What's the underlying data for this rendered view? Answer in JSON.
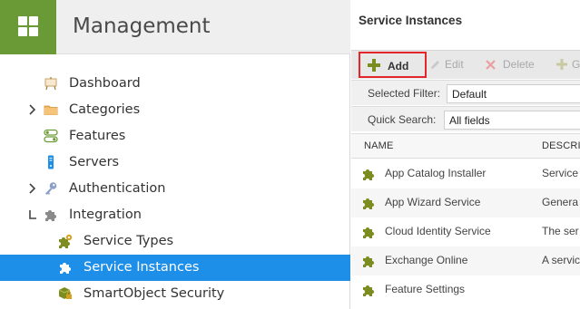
{
  "management": {
    "title": "Management"
  },
  "nav": {
    "items": [
      {
        "label": "Dashboard",
        "icon": "easel-icon"
      },
      {
        "label": "Categories",
        "icon": "folder-icon",
        "expandable": true
      },
      {
        "label": "Features",
        "icon": "toggle-icon"
      },
      {
        "label": "Servers",
        "icon": "server-icon"
      },
      {
        "label": "Authentication",
        "icon": "key-icon",
        "expandable": true
      },
      {
        "label": "Integration",
        "icon": "puzzle-icon",
        "expanded": true
      },
      {
        "label": "Service Types",
        "icon": "puzzle-gear-icon"
      },
      {
        "label": "Service Instances",
        "icon": "puzzle-icon",
        "selected": true
      },
      {
        "label": "SmartObject Security",
        "icon": "smartobject-lock-icon"
      }
    ]
  },
  "page": {
    "title": "Service Instances"
  },
  "toolbar": {
    "add_label": "Add",
    "edit_label": "Edit",
    "delete_label": "Delete",
    "partial_label": "G"
  },
  "filters": {
    "selected_filter_label": "Selected Filter:",
    "selected_filter_value": "Default",
    "quick_search_label": "Quick Search:",
    "quick_search_value": "All fields"
  },
  "table": {
    "columns": [
      "NAME",
      "DESCRI"
    ],
    "rows": [
      {
        "name": "App Catalog Installer",
        "desc": "Service"
      },
      {
        "name": "App Wizard Service",
        "desc": "Genera"
      },
      {
        "name": "Cloud Identity Service",
        "desc": "The ser"
      },
      {
        "name": "Exchange Online",
        "desc": "A servic"
      },
      {
        "name": "Feature Settings",
        "desc": ""
      }
    ]
  },
  "colors": {
    "brand_green": "#6a9a35",
    "selection_blue": "#1e8fe8",
    "highlight_red": "#e2262b",
    "puzzle_olive": "#7d8c1e"
  }
}
